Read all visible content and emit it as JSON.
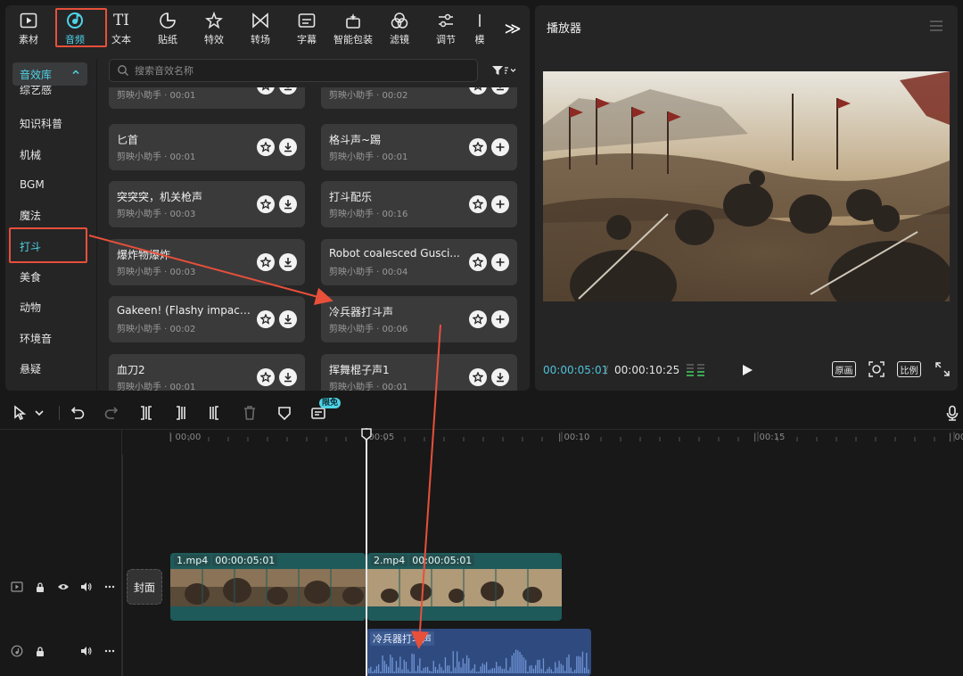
{
  "toolbar": {
    "tabs": [
      {
        "label": "素材",
        "icon": "media-icon"
      },
      {
        "label": "音频",
        "icon": "audio-icon",
        "active": true
      },
      {
        "label": "文本",
        "icon": "text-icon"
      },
      {
        "label": "贴纸",
        "icon": "sticker-icon"
      },
      {
        "label": "特效",
        "icon": "effects-icon"
      },
      {
        "label": "转场",
        "icon": "transition-icon"
      },
      {
        "label": "字幕",
        "icon": "subtitle-icon"
      },
      {
        "label": "智能包装",
        "icon": "smart-pack-icon"
      },
      {
        "label": "滤镜",
        "icon": "filter-icon"
      },
      {
        "label": "调节",
        "icon": "adjust-icon"
      },
      {
        "label": "模",
        "icon": "template-icon"
      }
    ],
    "text_icon_glyph": "TI",
    "expand_glyph": "≫"
  },
  "sidebar": {
    "header": "音效库",
    "items": [
      "综艺感",
      "知识科普",
      "机械",
      "BGM",
      "魔法",
      "打斗",
      "美食",
      "动物",
      "环境音",
      "悬疑"
    ],
    "active": "打斗"
  },
  "search": {
    "placeholder": "搜索音效名称"
  },
  "sounds": [
    {
      "title": "",
      "meta": "剪映小助手 · 00:01",
      "action": "download"
    },
    {
      "title": "",
      "meta": "剪映小助手 · 00:02",
      "action": "download"
    },
    {
      "title": "匕首",
      "meta": "剪映小助手 · 00:01",
      "action": "download"
    },
    {
      "title": "格斗声~踢",
      "meta": "剪映小助手 · 00:01",
      "action": "add"
    },
    {
      "title": "突突突，机关枪声",
      "meta": "剪映小助手 · 00:03",
      "action": "download"
    },
    {
      "title": "打斗配乐",
      "meta": "剪映小助手 · 00:16",
      "action": "add"
    },
    {
      "title": "爆炸物爆炸",
      "meta": "剪映小助手 · 00:03",
      "action": "download"
    },
    {
      "title": "Robot coalesced Gusci...",
      "meta": "剪映小助手 · 00:04",
      "action": "add"
    },
    {
      "title": "Gakeen! (Flashy impact...",
      "meta": "剪映小助手 · 00:02",
      "action": "download"
    },
    {
      "title": "冷兵器打斗声",
      "meta": "剪映小助手 · 00:06",
      "action": "add"
    },
    {
      "title": "血刀2",
      "meta": "剪映小助手 · 00:01",
      "action": "download"
    },
    {
      "title": "挥舞棍子声1",
      "meta": "剪映小助手 · 00:01",
      "action": "download"
    }
  ],
  "player": {
    "title": "播放器",
    "current_time": "00:00:05:01",
    "separator": "/",
    "total_time": "00:00:10:25",
    "original_btn": "原画",
    "ratio_btn": "比例"
  },
  "timeline": {
    "free_badge": "限免",
    "ruler_ticks": [
      "| 00:00",
      "|00:05",
      "| 00:10",
      "| 00:15",
      "| 00"
    ],
    "cover_label": "封面",
    "clips": [
      {
        "name": "1.mp4",
        "duration": "00:00:05:01"
      },
      {
        "name": "2.mp4",
        "duration": "00:00:05:01"
      }
    ],
    "audio_clip": {
      "name": "冷兵器打斗声"
    }
  },
  "colors": {
    "accent": "#4fd3e6",
    "highlight": "#e8503a",
    "audio_clip": "#2f4a7e",
    "video_clip": "#1f5a5a"
  }
}
